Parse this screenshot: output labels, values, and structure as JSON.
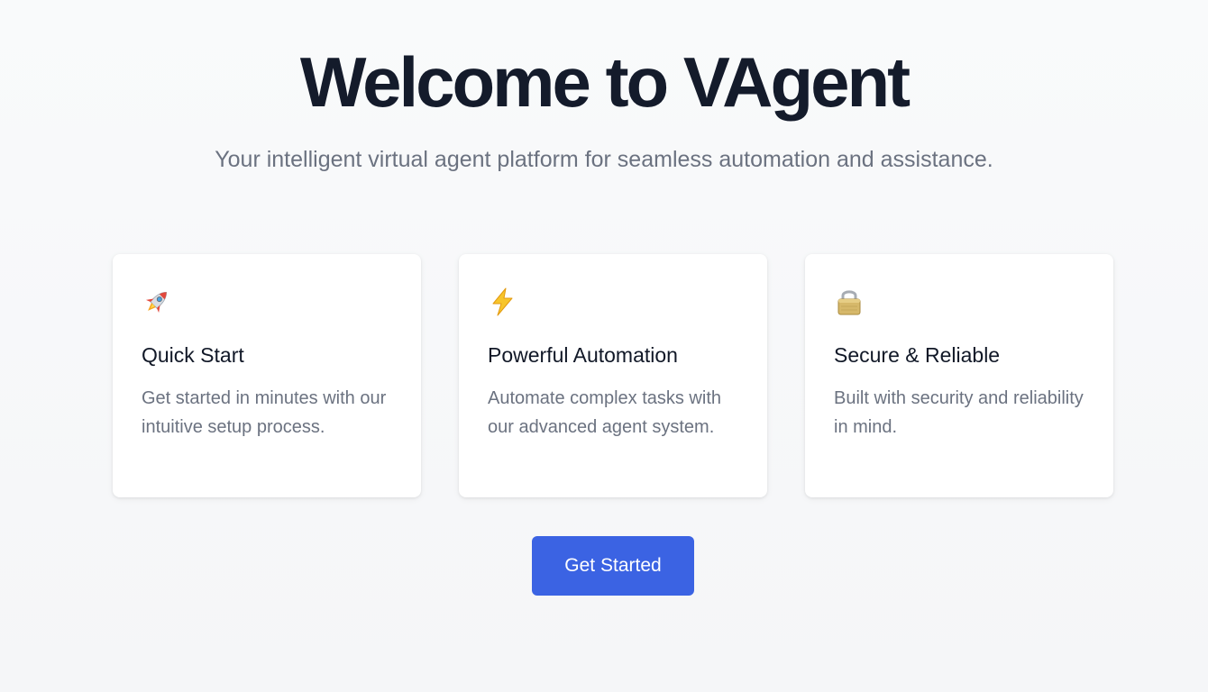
{
  "hero": {
    "title": "Welcome to VAgent",
    "subtitle": "Your intelligent virtual agent platform for seamless automation and assistance."
  },
  "features": [
    {
      "icon": "rocket-icon",
      "title": "Quick Start",
      "description": "Get started in minutes with our intuitive setup process."
    },
    {
      "icon": "lightning-icon",
      "title": "Powerful Automation",
      "description": "Automate complex tasks with our advanced agent system."
    },
    {
      "icon": "lock-icon",
      "title": "Secure & Reliable",
      "description": "Built with security and reliability in mind."
    }
  ],
  "cta": {
    "label": "Get Started"
  },
  "colors": {
    "primary": "#3b63e3",
    "heading": "#141b2b",
    "muted": "#6b7280",
    "background": "#f7f8fa",
    "card": "#ffffff"
  }
}
